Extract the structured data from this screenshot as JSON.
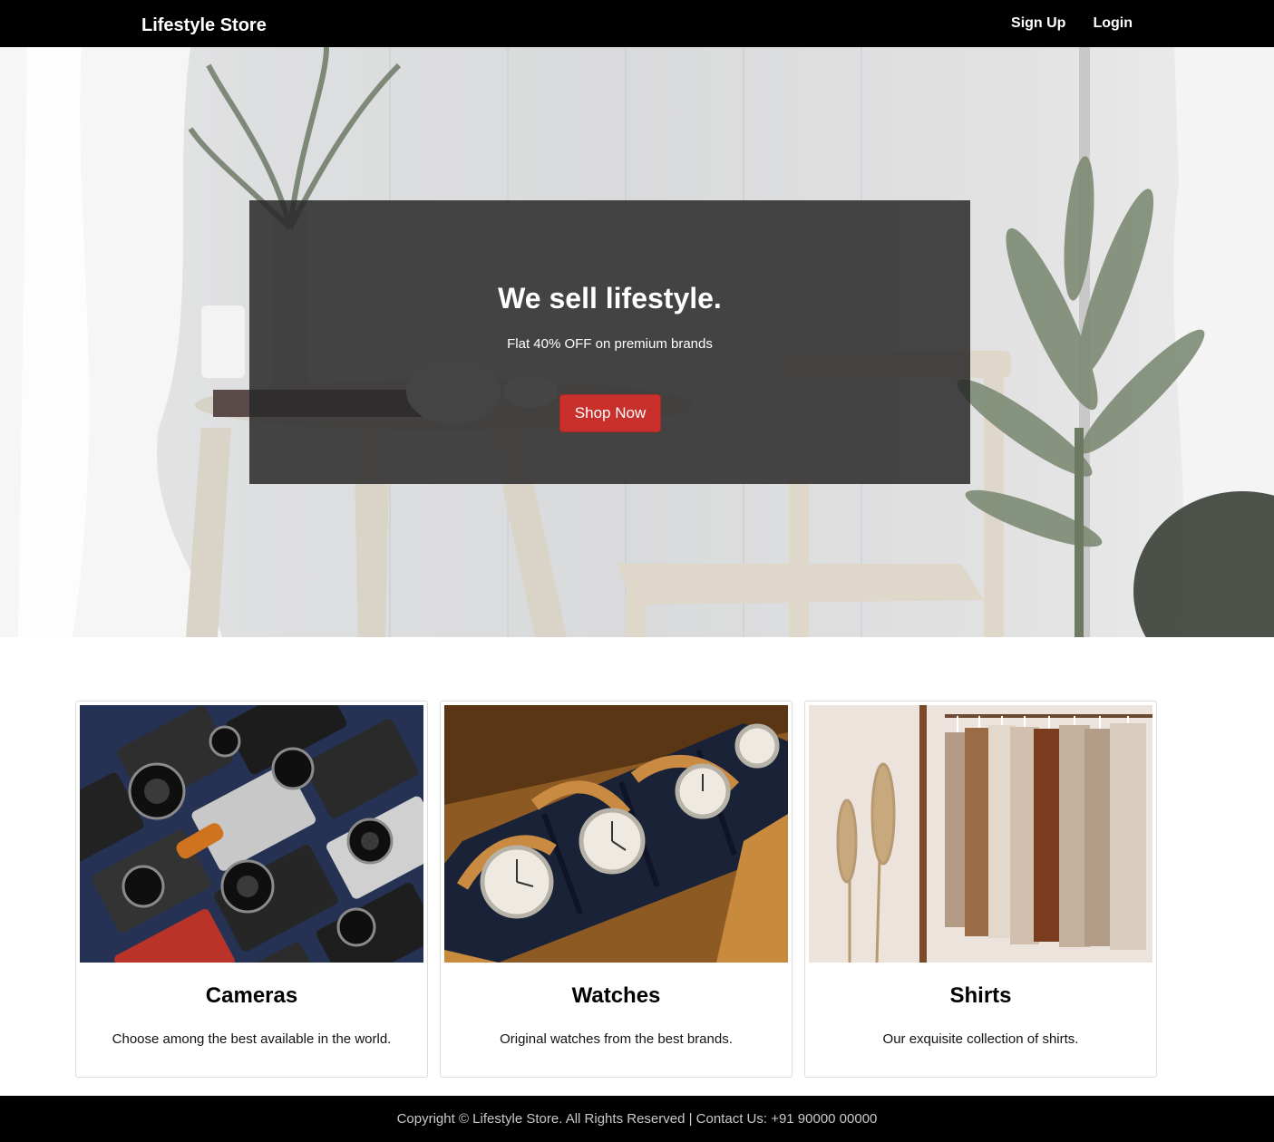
{
  "navbar": {
    "brand": "Lifestyle Store",
    "links": [
      {
        "label": "Sign Up",
        "icon": "user-icon"
      },
      {
        "label": "Login",
        "icon": "login-icon"
      }
    ]
  },
  "hero": {
    "title": "We sell lifestyle.",
    "subtitle": "Flat 40% OFF on premium brands",
    "button": "Shop Now",
    "button_color": "#c9302c",
    "background_image": "interior-photo-with-table-chair-plants"
  },
  "cards": [
    {
      "title": "Cameras",
      "text": "Choose among the best available in the world.",
      "image": "cameras-photo"
    },
    {
      "title": "Watches",
      "text": "Original watches from the best brands.",
      "image": "watches-photo"
    },
    {
      "title": "Shirts",
      "text": "Our exquisite collection of shirts.",
      "image": "shirts-photo"
    }
  ],
  "footer": {
    "text": "Copyright © Lifestyle Store. All Rights Reserved | Contact Us: +91 90000 00000"
  }
}
